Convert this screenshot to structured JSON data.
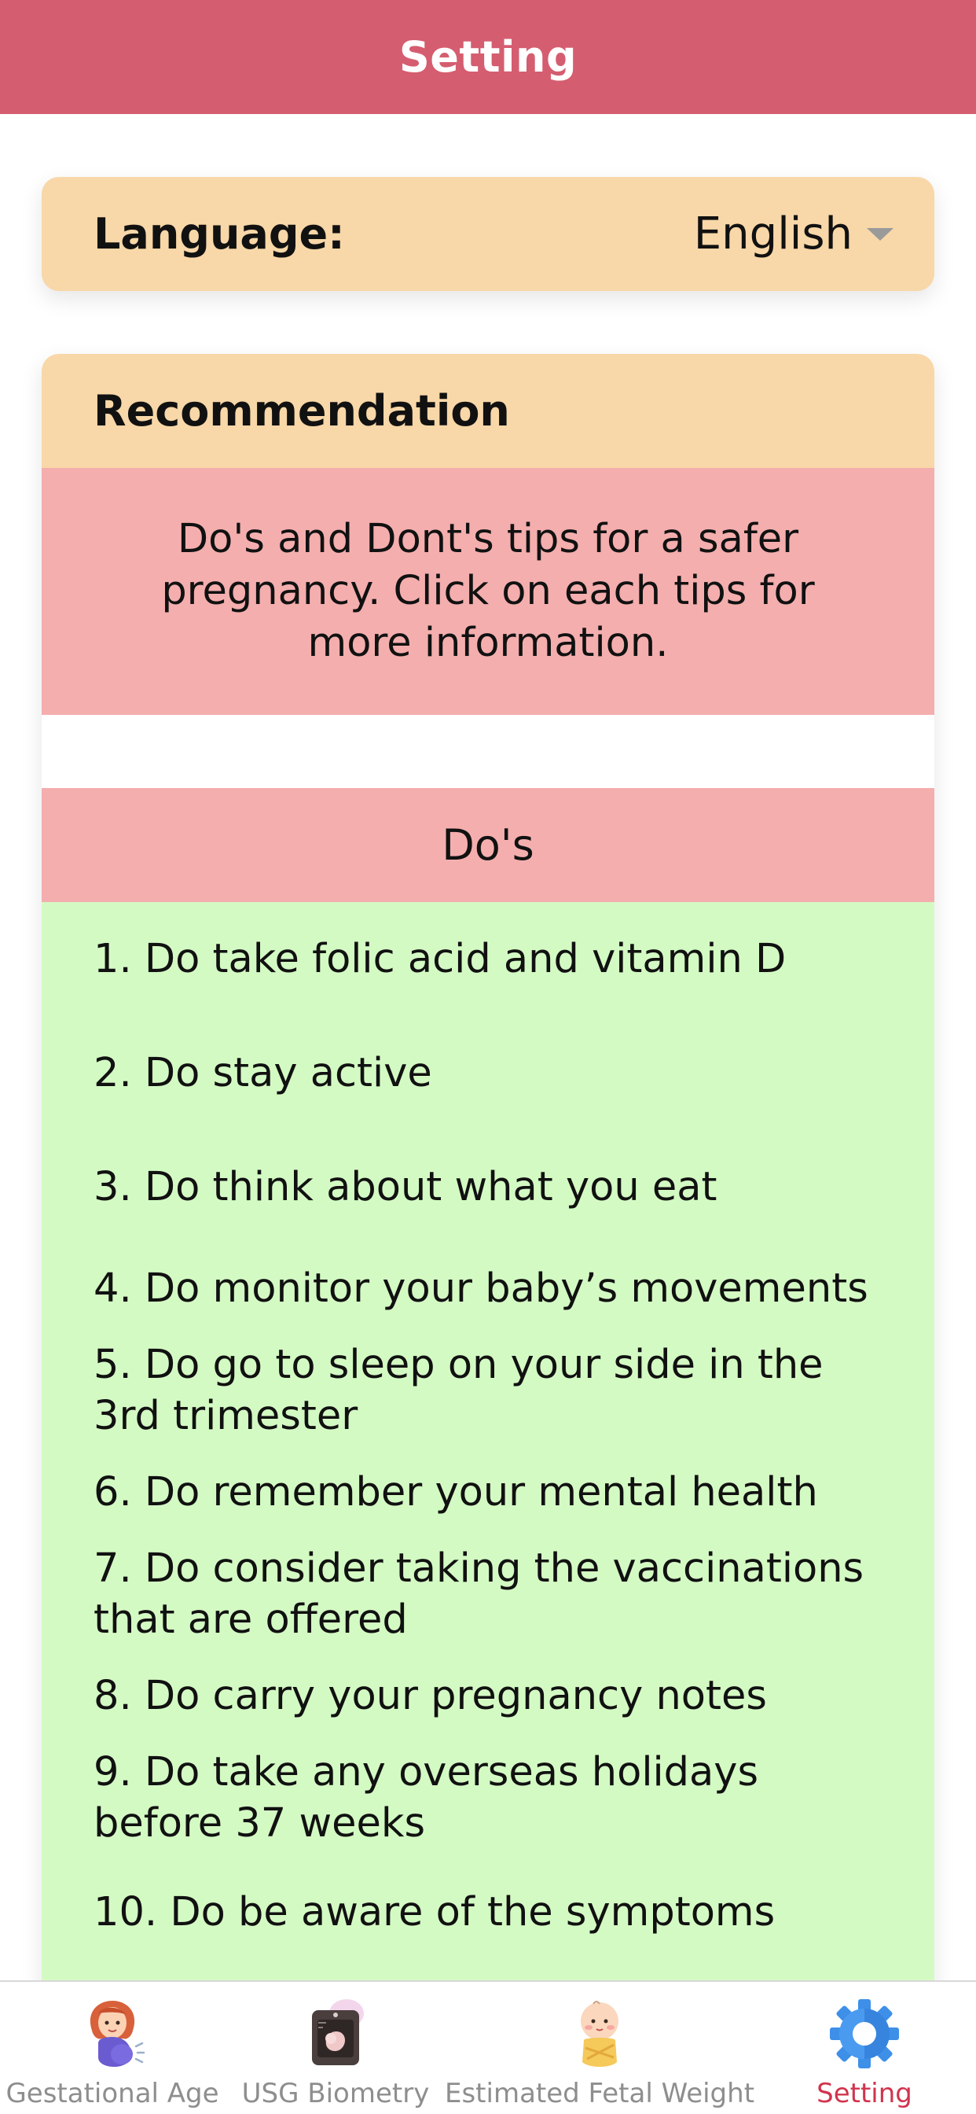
{
  "header": {
    "title": "Setting"
  },
  "language": {
    "label": "Language:",
    "value": "English"
  },
  "recommendation": {
    "title": "Recommendation",
    "intro": "Do's and Dont's tips for a safer pregnancy. Click on each tips for more information.",
    "dos_title": "Do's",
    "dos": [
      "1. Do take folic acid and vitamin D",
      "2. Do stay active",
      "3. Do think about what you eat",
      "4. Do monitor your baby’s movements",
      "5. Do go to sleep on your side in the 3rd trimester",
      "6. Do remember your mental health",
      "7. Do consider taking the vaccinations that are offered",
      "8. Do carry your pregnancy notes",
      "9. Do take any overseas holidays before 37 weeks",
      "10. Do be aware of the symptoms"
    ]
  },
  "tabs": [
    {
      "label": "Gestational Age",
      "icon": "pregnant-woman-icon"
    },
    {
      "label": "USG Biometry",
      "icon": "ultrasound-icon"
    },
    {
      "label": "Estimated Fetal Weight",
      "icon": "baby-icon"
    },
    {
      "label": "Setting",
      "icon": "gear-icon",
      "active": true
    }
  ],
  "colors": {
    "header": "#d55d70",
    "card_header": "#f8d7a8",
    "pink_band": "#f4aeae",
    "green_list": "#d4fac4",
    "active_tab": "#d1344d",
    "inactive_tab": "#8e8e8e"
  }
}
